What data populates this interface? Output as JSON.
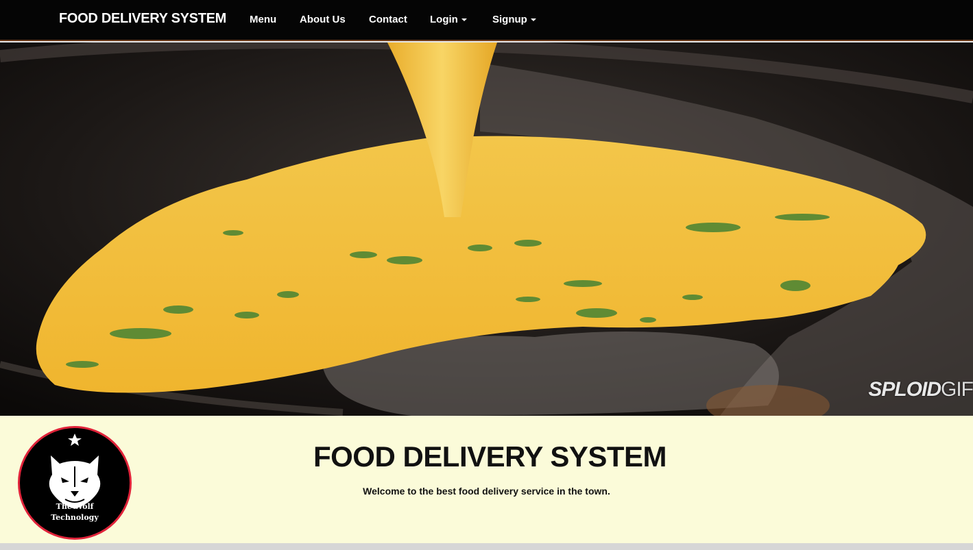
{
  "navbar": {
    "brand": "FOOD DELIVERY SYSTEM",
    "items": [
      {
        "label": "Menu",
        "dropdown": false
      },
      {
        "label": "About Us",
        "dropdown": false
      },
      {
        "label": "Contact",
        "dropdown": false
      },
      {
        "label": "Login",
        "dropdown": true
      },
      {
        "label": "Signup",
        "dropdown": true
      }
    ]
  },
  "hero": {
    "image_icon": "omelette-pan-image",
    "watermark_bold": "SPLOID",
    "watermark_light": "GIF"
  },
  "intro": {
    "logo_icon": "wolf-logo",
    "logo_line1": "The Wolf",
    "logo_line2": "Technology",
    "title": "FOOD DELIVERY SYSTEM",
    "subtitle": "Welcome to the best food delivery service in the town."
  },
  "colors": {
    "navbar_bg": "#050505",
    "intro_bg": "#fbfbd9",
    "logo_border": "#e0233a",
    "egg_yellow": "#f2c23a"
  }
}
